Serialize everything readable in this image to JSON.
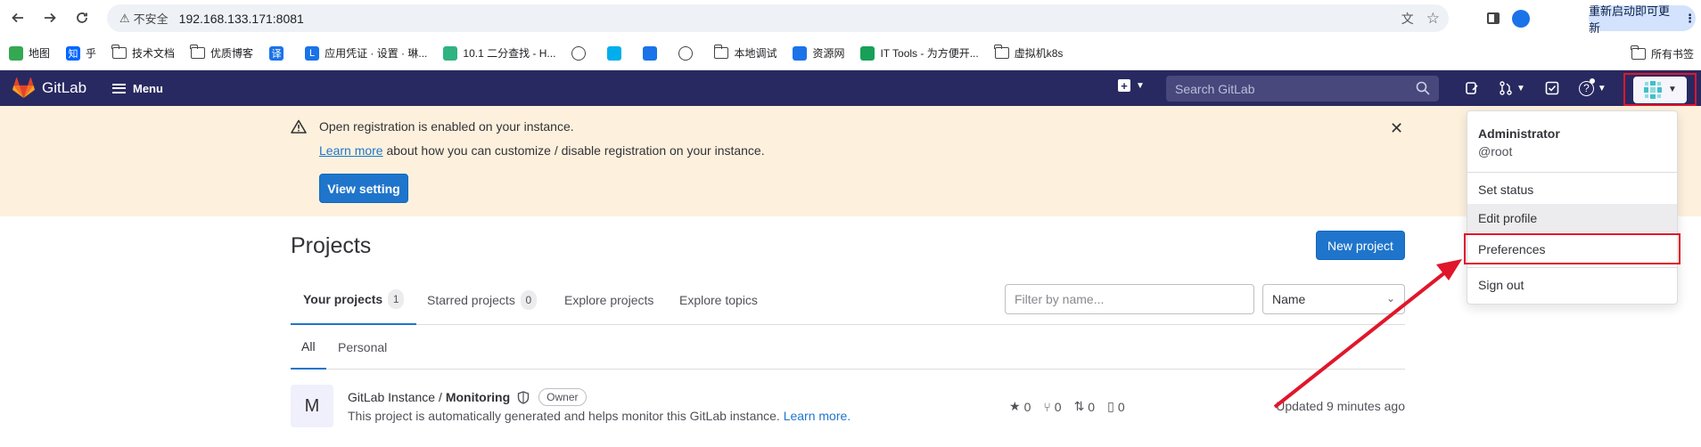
{
  "browser": {
    "insecure_label": "不安全",
    "url": "192.168.133.171:8081",
    "update_button": "重新启动即可更新",
    "bookmarks": [
      {
        "label": "地图",
        "icon": "map-icon",
        "color": "#34a853"
      },
      {
        "label": "乎",
        "icon": "zhihu-icon",
        "color": "#0066ff",
        "badge": "知"
      },
      {
        "label": "技术文档",
        "icon": "folder-icon"
      },
      {
        "label": "优质博客",
        "icon": "folder-icon"
      },
      {
        "label": "",
        "icon": "translate-icon",
        "color": "#1a73e8",
        "badge": "译"
      },
      {
        "label": "应用凭证 · 设置 · 琳...",
        "icon": "app-icon",
        "color": "#1a73e8",
        "badge": "L"
      },
      {
        "label": "10.1   二分查找 - H...",
        "icon": "leaf-icon",
        "color": "#2fb380"
      },
      {
        "label": "",
        "icon": "globe-icon"
      },
      {
        "label": "",
        "icon": "bilibili-icon",
        "color": "#00aeec"
      },
      {
        "label": "",
        "icon": "bookmark-blue-icon",
        "color": "#1a73e8"
      },
      {
        "label": "",
        "icon": "globe-icon"
      },
      {
        "label": "本地调试",
        "icon": "folder-icon"
      },
      {
        "label": "资源网",
        "icon": "monitor-icon",
        "color": "#1a73e8"
      },
      {
        "label": "IT Tools - 为方便开...",
        "icon": "tools-icon",
        "color": "#18a058"
      },
      {
        "label": "虚拟机k8s",
        "icon": "folder-icon"
      }
    ],
    "all_bookmarks": "所有书签"
  },
  "gitlab": {
    "brand": "GitLab",
    "brand_color": "#fc6d26",
    "topbar_color": "#292961",
    "menu_label": "Menu",
    "search_placeholder": "Search GitLab"
  },
  "alert": {
    "title": "Open registration is enabled on your instance.",
    "link_text": "Learn more",
    "body_text": " about how you can customize / disable registration on your instance.",
    "button": "View setting"
  },
  "page": {
    "title": "Projects",
    "new_project": "New project",
    "tabs": [
      {
        "label": "Your projects",
        "count": "1",
        "active": true
      },
      {
        "label": "Starred projects",
        "count": "0",
        "active": false
      },
      {
        "label": "Explore projects",
        "active": false
      },
      {
        "label": "Explore topics",
        "active": false
      }
    ],
    "filter_placeholder": "Filter by name...",
    "sort_value": "Name",
    "subtabs": [
      {
        "label": "All",
        "active": true
      },
      {
        "label": "Personal",
        "active": false
      }
    ],
    "projects": [
      {
        "avatar_letter": "M",
        "namespace": "GitLab Instance /",
        "name": "Monitoring",
        "badge": "Owner",
        "description": "This project is automatically generated and helps monitor this GitLab instance.",
        "learn_more": "Learn more.",
        "stars": "0",
        "forks": "0",
        "merge_requests": "0",
        "issues": "0",
        "updated": "Updated 9 minutes ago"
      }
    ]
  },
  "user_menu": {
    "name": "Administrator",
    "handle": "@root",
    "items": [
      "Set status",
      "Edit profile",
      "Preferences",
      "Sign out"
    ],
    "highlight_color": "#e0162b"
  }
}
